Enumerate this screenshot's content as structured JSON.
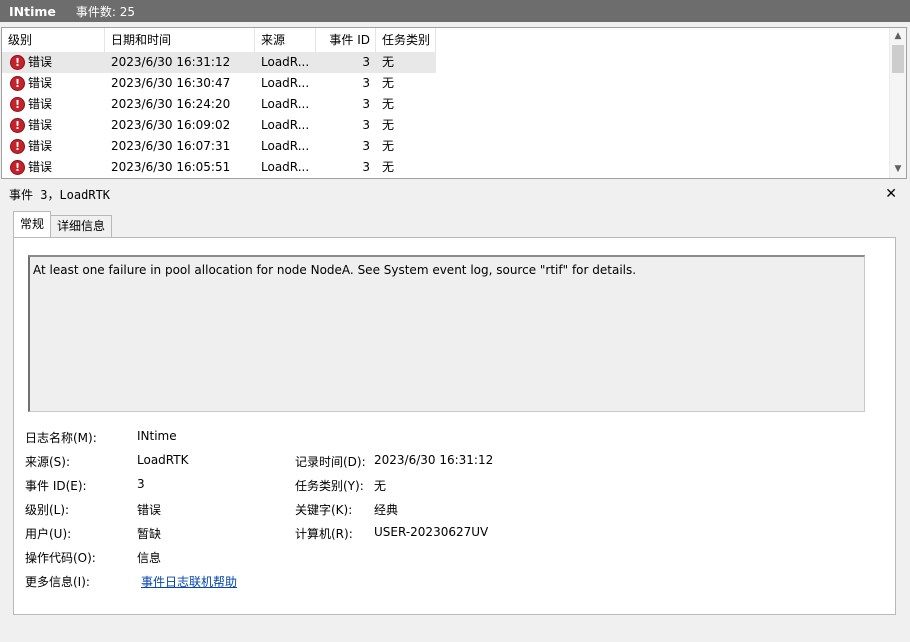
{
  "titlebar": {
    "log_name": "INtime",
    "event_count": "事件数: 25"
  },
  "list": {
    "columns": [
      "级别",
      "日期和时间",
      "来源",
      "事件 ID",
      "任务类别"
    ],
    "rows": [
      {
        "level": "错误",
        "datetime": "2023/6/30 16:31:12",
        "source": "LoadR...",
        "event_id": "3",
        "task": "无"
      },
      {
        "level": "错误",
        "datetime": "2023/6/30 16:30:47",
        "source": "LoadR...",
        "event_id": "3",
        "task": "无"
      },
      {
        "level": "错误",
        "datetime": "2023/6/30 16:24:20",
        "source": "LoadR...",
        "event_id": "3",
        "task": "无"
      },
      {
        "level": "错误",
        "datetime": "2023/6/30 16:09:02",
        "source": "LoadR...",
        "event_id": "3",
        "task": "无"
      },
      {
        "level": "错误",
        "datetime": "2023/6/30 16:07:31",
        "source": "LoadR...",
        "event_id": "3",
        "task": "无"
      },
      {
        "level": "错误",
        "datetime": "2023/6/30 16:05:51",
        "source": "LoadR...",
        "event_id": "3",
        "task": "无"
      }
    ],
    "error_icon_glyph": "!"
  },
  "detail": {
    "title": "事件 3，LoadRTK",
    "close_glyph": "✕",
    "tabs": [
      "常规",
      "详细信息"
    ],
    "description": "At least one failure in pool allocation for node NodeA. See System event log, source \"rtif\" for details.",
    "props": {
      "log_name_label": "日志名称(M):",
      "log_name_value": "INtime",
      "source_label": "来源(S):",
      "source_value": "LoadRTK",
      "logged_label": "记录时间(D):",
      "logged_value": "2023/6/30 16:31:12",
      "event_id_label": "事件 ID(E):",
      "event_id_value": "3",
      "task_label": "任务类别(Y):",
      "task_value": "无",
      "level_label": "级别(L):",
      "level_value": "错误",
      "keywords_label": "关键字(K):",
      "keywords_value": "经典",
      "user_label": "用户(U):",
      "user_value": "暂缺",
      "computer_label": "计算机(R):",
      "computer_value": "USER-20230627UV",
      "opcode_label": "操作代码(O):",
      "opcode_value": "信息",
      "more_info_label": "更多信息(I):",
      "more_info_link": "事件日志联机帮助"
    }
  },
  "colors": {
    "titlebar": "#6d6d6d",
    "error_icon": "#c4232b",
    "link": "#0645ad"
  }
}
